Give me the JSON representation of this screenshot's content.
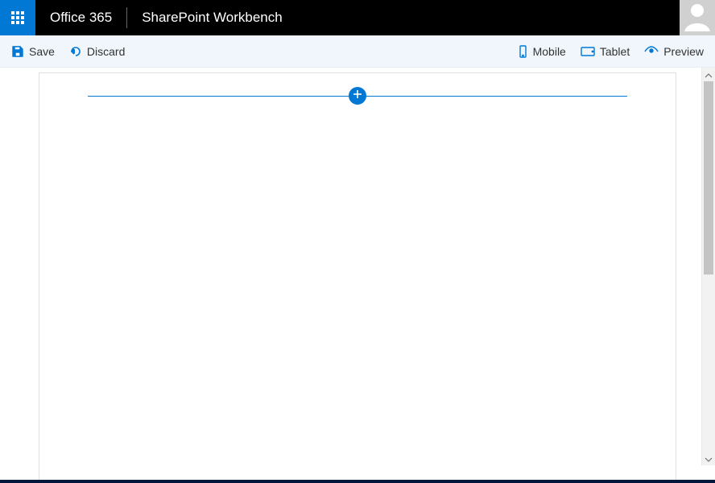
{
  "header": {
    "brand": "Office 365",
    "page_title": "SharePoint Workbench"
  },
  "commands": {
    "save": "Save",
    "discard": "Discard",
    "mobile": "Mobile",
    "tablet": "Tablet",
    "preview": "Preview"
  },
  "colors": {
    "accent": "#0078d4",
    "topbar": "#000000",
    "cmdbar": "#f0f6fb"
  }
}
